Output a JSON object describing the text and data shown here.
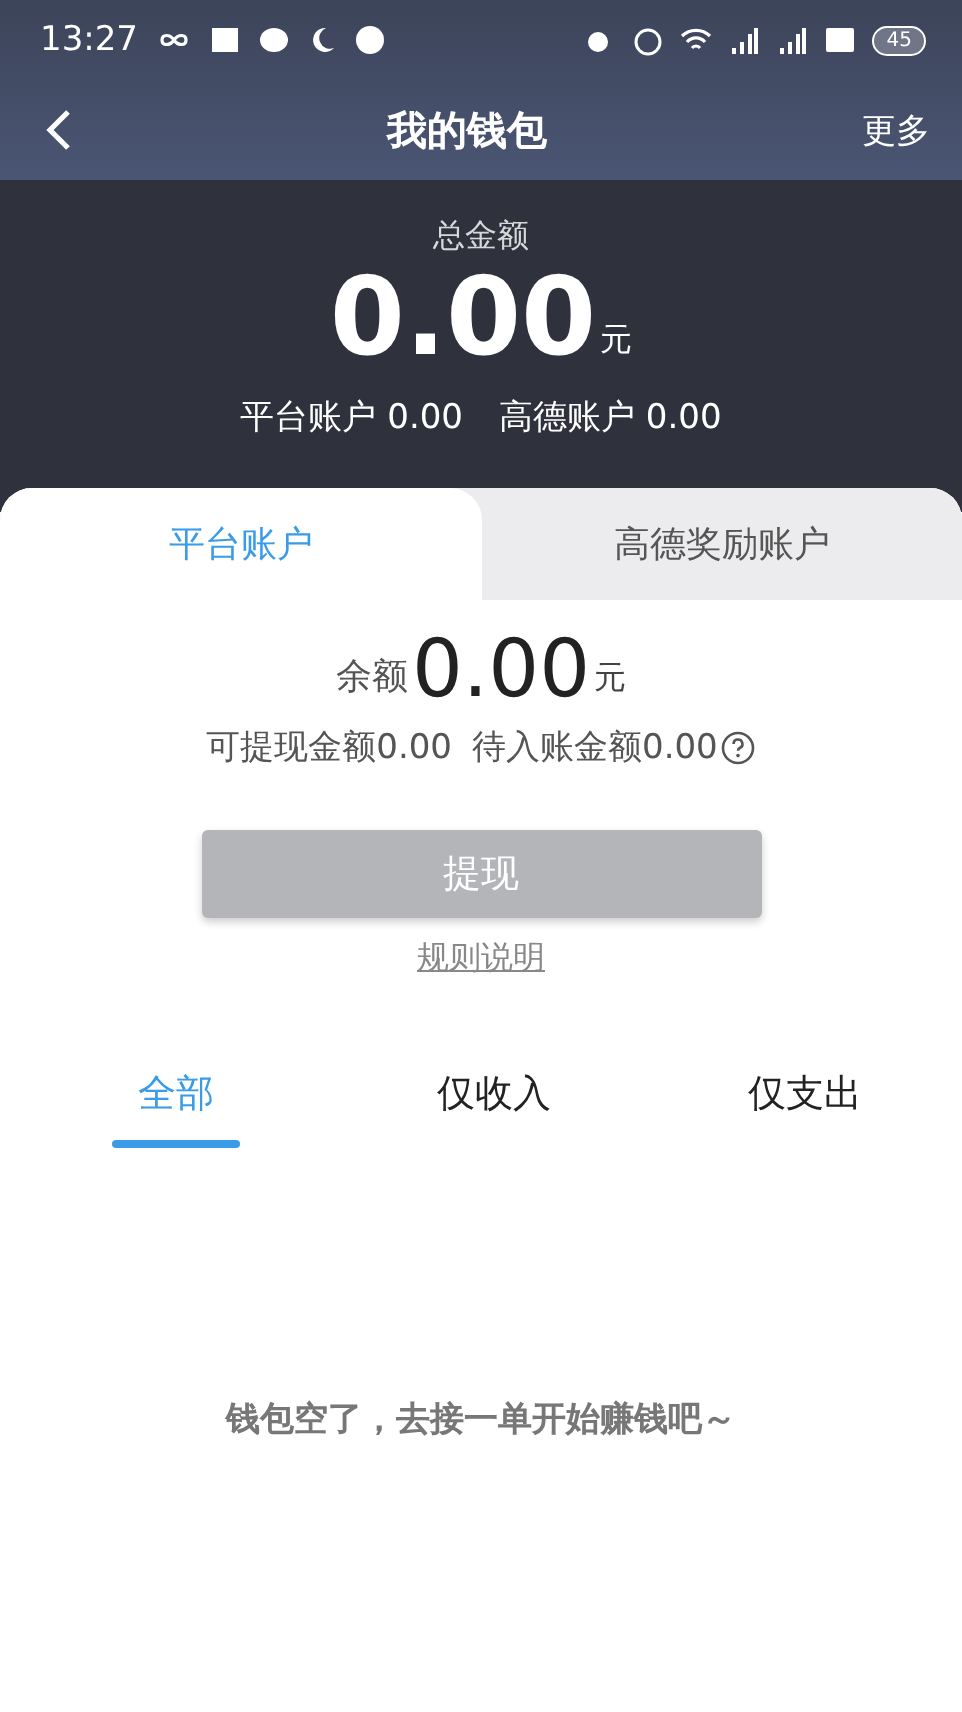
{
  "status_bar": {
    "time": "13:27",
    "battery": "45"
  },
  "header": {
    "title": "我的钱包",
    "more": "更多"
  },
  "summary": {
    "label": "总金额",
    "amount": "0.00",
    "unit": "元",
    "accounts": [
      {
        "label": "平台账户 0.00"
      },
      {
        "label": "高德账户 0.00"
      }
    ]
  },
  "account_tabs": [
    {
      "label": "平台账户",
      "selected": true
    },
    {
      "label": "高德奖励账户",
      "selected": false
    }
  ],
  "balance": {
    "label": "余额",
    "amount": "0.00",
    "unit": "元",
    "withdrawable": "可提现金额0.00",
    "pending": "待入账金额0.00"
  },
  "withdraw_button": {
    "label": "提现",
    "disabled": true
  },
  "rules_link": "规则说明",
  "filter_tabs": [
    {
      "label": "全部",
      "selected": true
    },
    {
      "label": "仅收入",
      "selected": false
    },
    {
      "label": "仅支出",
      "selected": false
    }
  ],
  "empty_message": "钱包空了，去接一单开始赚钱吧～"
}
